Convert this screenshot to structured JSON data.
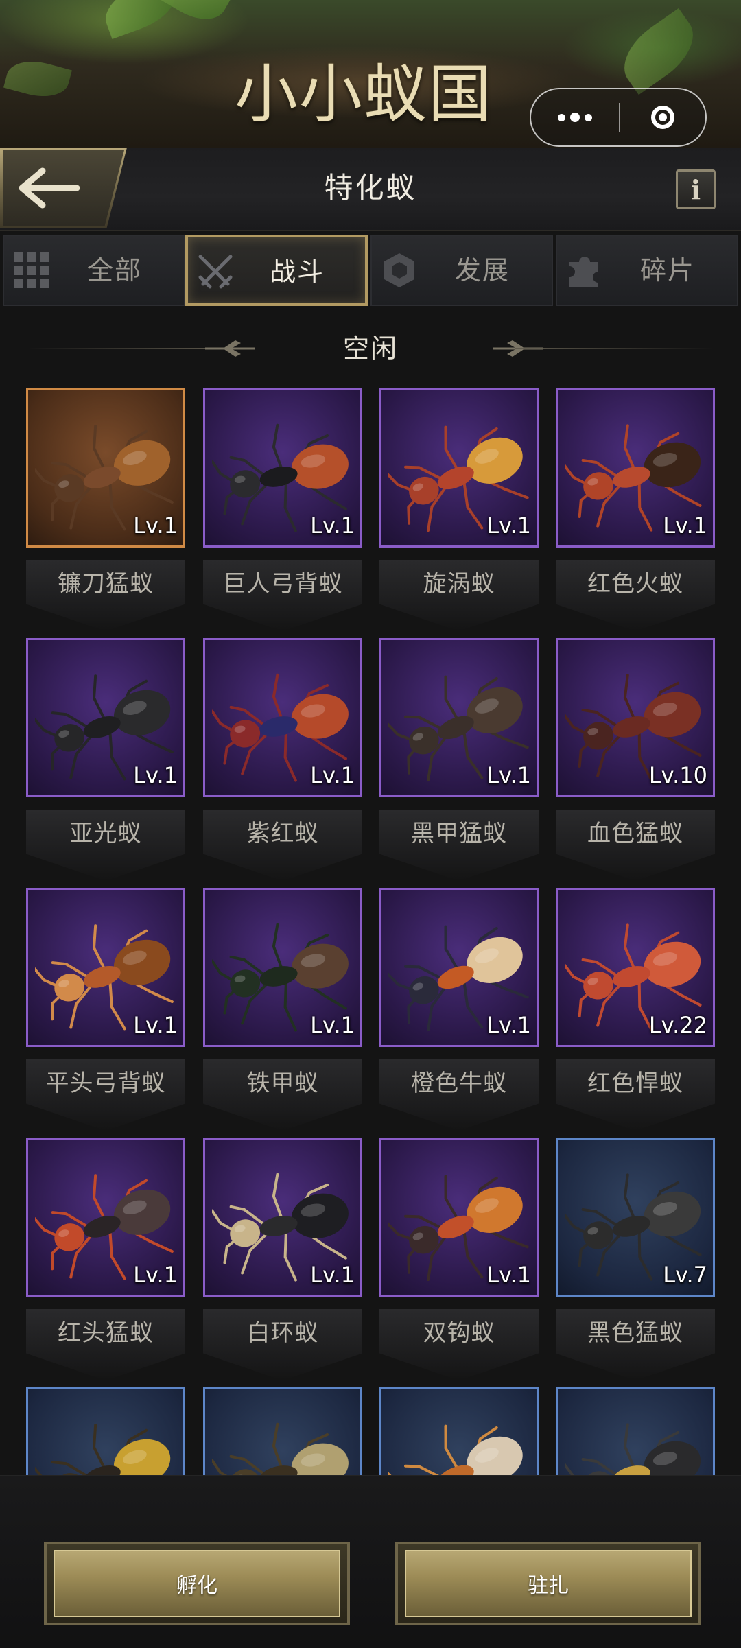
{
  "banner": {
    "logo_text": "小小蚁国"
  },
  "header": {
    "title": "特化蚁",
    "info_glyph": "i"
  },
  "tabs": [
    {
      "label": "全部",
      "icon": "grid-icon",
      "active": false
    },
    {
      "label": "战斗",
      "icon": "crossed-swords-icon",
      "active": true
    },
    {
      "label": "发展",
      "icon": "hexagon-icon",
      "active": false
    },
    {
      "label": "碎片",
      "icon": "puzzle-piece-icon",
      "active": false
    }
  ],
  "section": {
    "title": "空闲"
  },
  "ants": [
    {
      "name": "镰刀猛蚁",
      "level": "Lv.1",
      "rarity": "orange",
      "body": "#7a4a2c",
      "head": "#5a3a24",
      "abdomen": "#a0622c"
    },
    {
      "name": "巨人弓背蚁",
      "level": "Lv.1",
      "rarity": "purple",
      "body": "#1b1b1e",
      "head": "#2b2b2e",
      "abdomen": "#b5502a"
    },
    {
      "name": "旋涡蚁",
      "level": "Lv.1",
      "rarity": "purple",
      "body": "#b4442c",
      "head": "#a8402a",
      "abdomen": "#d79a3a"
    },
    {
      "name": "红色火蚁",
      "level": "Lv.1",
      "rarity": "purple",
      "body": "#b84a2e",
      "head": "#b04428",
      "abdomen": "#3a2418"
    },
    {
      "name": "亚光蚁",
      "level": "Lv.1",
      "rarity": "purple",
      "body": "#1f1f21",
      "head": "#262628",
      "abdomen": "#2a2a2c"
    },
    {
      "name": "紫红蚁",
      "level": "Lv.1",
      "rarity": "purple",
      "body": "#2a2a6a",
      "head": "#8a2a2a",
      "abdomen": "#b54a2a"
    },
    {
      "name": "黑甲猛蚁",
      "level": "Lv.1",
      "rarity": "purple",
      "body": "#3a2f2a",
      "head": "#3a302a",
      "abdomen": "#4a3a30"
    },
    {
      "name": "血色猛蚁",
      "level": "Lv.10",
      "rarity": "purple",
      "body": "#6a2a22",
      "head": "#4a2420",
      "abdomen": "#7a3024"
    },
    {
      "name": "平头弓背蚁",
      "level": "Lv.1",
      "rarity": "purple",
      "body": "#b45a2a",
      "head": "#d28a4a",
      "abdomen": "#8a4a1e"
    },
    {
      "name": "铁甲蚁",
      "level": "Lv.1",
      "rarity": "purple",
      "body": "#1e2a1e",
      "head": "#223022",
      "abdomen": "#5a4030"
    },
    {
      "name": "橙色牛蚁",
      "level": "Lv.1",
      "rarity": "purple",
      "body": "#c45a24",
      "head": "#2a2a3a",
      "abdomen": "#e0c49a"
    },
    {
      "name": "红色悍蚁",
      "level": "Lv.22",
      "rarity": "purple",
      "body": "#c24a30",
      "head": "#c04a30",
      "abdomen": "#d05a3a"
    },
    {
      "name": "红头猛蚁",
      "level": "Lv.1",
      "rarity": "purple",
      "body": "#2a2426",
      "head": "#c24a2a",
      "abdomen": "#4a3a3a"
    },
    {
      "name": "白环蚁",
      "level": "Lv.1",
      "rarity": "purple",
      "body": "#2a2a2c",
      "head": "#c8b48a",
      "abdomen": "#1e1e22"
    },
    {
      "name": "双钩蚁",
      "level": "Lv.1",
      "rarity": "purple",
      "body": "#c2502a",
      "head": "#3a2a2a",
      "abdomen": "#d0782e"
    },
    {
      "name": "黑色猛蚁",
      "level": "Lv.7",
      "rarity": "blue",
      "body": "#2a2a2a",
      "head": "#2c2c2c",
      "abdomen": "#3a3a3a"
    },
    {
      "name": "",
      "level": "",
      "rarity": "blue",
      "body": "#2a241e",
      "head": "#3a3020",
      "abdomen": "#c8a030"
    },
    {
      "name": "",
      "level": "",
      "rarity": "blue",
      "body": "#3a3020",
      "head": "#4a3e28",
      "abdomen": "#b0a070"
    },
    {
      "name": "",
      "level": "",
      "rarity": "blue",
      "body": "#c06a2a",
      "head": "#d08a40",
      "abdomen": "#d8c8b0"
    },
    {
      "name": "",
      "level": "",
      "rarity": "blue",
      "body": "#c8a040",
      "head": "#3a3a3a",
      "abdomen": "#2a2a2c"
    }
  ],
  "actions": {
    "hatch_label": "孵化",
    "station_label": "驻扎"
  },
  "colors": {
    "accent_gold": "#b29a62",
    "rarity_purple": "#8a5cc8",
    "rarity_orange": "#d08a45",
    "rarity_blue": "#5d86c8"
  }
}
